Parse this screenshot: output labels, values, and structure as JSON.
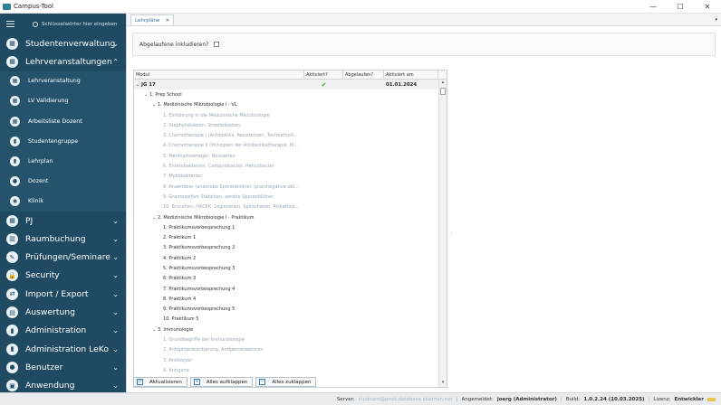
{
  "window": {
    "title": "Campus-Tool",
    "minimize": "—",
    "maximize": "☐",
    "close": "✕"
  },
  "sidebar": {
    "search_placeholder": "Schlüsselwörter hier eingeben",
    "items": [
      {
        "label": "Studentenverwaltung",
        "icon": "graduation-icon",
        "glyph": "▦",
        "chevron": "⌄"
      },
      {
        "label": "Lehrveranstaltungen",
        "icon": "graduation-icon",
        "glyph": "▦",
        "chevron": "⌃"
      },
      {
        "label": "PJ",
        "icon": "graduation-icon",
        "glyph": "▦",
        "chevron": "⌄"
      },
      {
        "label": "Raumbuchung",
        "icon": "building-icon",
        "glyph": "▥",
        "chevron": "⌄"
      },
      {
        "label": "Prüfungen/Seminare",
        "icon": "pen-icon",
        "glyph": "✎",
        "chevron": "⌄"
      },
      {
        "label": "Security",
        "icon": "lock-icon",
        "glyph": "🔒",
        "chevron": "⌄"
      },
      {
        "label": "Import / Export",
        "icon": "exchange-icon",
        "glyph": "⇄",
        "chevron": "⌄"
      },
      {
        "label": "Auswertung",
        "icon": "chart-icon",
        "glyph": "▤",
        "chevron": "⌄"
      },
      {
        "label": "Administration",
        "icon": "tool-icon",
        "glyph": "▮",
        "chevron": "⌄"
      },
      {
        "label": "Administration LeKo",
        "icon": "tool-icon",
        "glyph": "▮",
        "chevron": "⌄"
      },
      {
        "label": "Benutzer",
        "icon": "user-icon",
        "glyph": "●",
        "chevron": "⌄"
      },
      {
        "label": "Anwendung",
        "icon": "app-icon",
        "glyph": "▣",
        "chevron": "⌄"
      }
    ],
    "subitems": [
      {
        "label": "Lehrveranstaltung",
        "icon": "calendar-icon",
        "glyph": "▦"
      },
      {
        "label": "LV Validierung",
        "icon": "calendar-icon",
        "glyph": "▦"
      },
      {
        "label": "Arbeitsliste Dozent",
        "icon": "calendar-icon",
        "glyph": "▦"
      },
      {
        "label": "Studentengruppe",
        "icon": "tool-icon",
        "glyph": "▮"
      },
      {
        "label": "Lehrplan",
        "icon": "tool-icon",
        "glyph": "▮"
      },
      {
        "label": "Dozent",
        "icon": "user-icon",
        "glyph": "●"
      },
      {
        "label": "Klinik",
        "icon": "clinic-icon",
        "glyph": "◉"
      }
    ]
  },
  "tabs": {
    "active": "Lehrpläne",
    "close": "×",
    "menu": "▾"
  },
  "filter": {
    "label": "Abgelaufene inkludieren?"
  },
  "grid": {
    "columns": [
      "Modul",
      "Aktiviert?",
      "Abgelaufen?",
      "Aktiviert am"
    ],
    "root": {
      "label": "JG 17",
      "aktiviert": "✔",
      "aktiviert_am": "01.01.2024"
    },
    "rows": [
      {
        "text": "1. Prep School",
        "level": 1,
        "toggle": "⌄",
        "blur": false
      },
      {
        "text": "1. Medizinische Mikrobiologie I - VL",
        "level": 2,
        "toggle": "⌄",
        "blur": false
      },
      {
        "text": "1. Einführung in die Medizinische Mikrobiologie",
        "level": 3,
        "blur": true
      },
      {
        "text": "2. Staphylokokken, Streptokokken",
        "level": 3,
        "blur": true
      },
      {
        "text": "3. Chemotherapie I (Antibiotika, Resistenzen, Testmethod...",
        "level": 3,
        "blur": true
      },
      {
        "text": "4. Chemotherapie II (Prinzipien der Antibiotikatherapie, M...",
        "level": 3,
        "blur": true
      },
      {
        "text": "5. Meningitiserreger, Neisserien",
        "level": 3,
        "blur": true
      },
      {
        "text": "6. Enterobakterien, Campylobacter, Helicobacter",
        "level": 3,
        "blur": true
      },
      {
        "text": "7. Mykobakterien",
        "level": 3,
        "blur": true
      },
      {
        "text": "8. Anaerobier (anaerobe Sporenbildner, gramnegative obl...",
        "level": 3,
        "blur": true
      },
      {
        "text": "9. Grampositive Stäbchen, aerobe Sporenbildner",
        "level": 3,
        "blur": true
      },
      {
        "text": "10. Brucellen, HACEK, Legionellen, Spirochäten, Rickettsie...",
        "level": 3,
        "blur": true
      },
      {
        "text": "2. Medizinische Mikrobiologie I - Praktikum",
        "level": 2,
        "toggle": "⌄",
        "blur": false
      },
      {
        "text": "1. Praktikumsvorbesprechung 1",
        "level": 3,
        "blur": false
      },
      {
        "text": "2. Praktikum 1",
        "level": 3,
        "blur": false
      },
      {
        "text": "3. Praktikumsvorbesprechung 2",
        "level": 3,
        "blur": false
      },
      {
        "text": "4. Praktikum 2",
        "level": 3,
        "blur": false
      },
      {
        "text": "5. Praktikumsvorbesprechung 3",
        "level": 3,
        "blur": false
      },
      {
        "text": "6. Praktikum 3",
        "level": 3,
        "blur": false
      },
      {
        "text": "7. Praktikumsvorbesprechung 4",
        "level": 3,
        "blur": false
      },
      {
        "text": "8. Praktikum 4",
        "level": 3,
        "blur": false
      },
      {
        "text": "9. Praktikumsvorbesprechung 5",
        "level": 3,
        "blur": false
      },
      {
        "text": "10. Praktikum 5",
        "level": 3,
        "blur": false
      },
      {
        "text": "3. Immunologie",
        "level": 2,
        "toggle": "⌄",
        "blur": false
      },
      {
        "text": "1. Grundbegriffe der Immunbiologie",
        "level": 3,
        "blur": true
      },
      {
        "text": "2. Antigenpräsentierung, Antigenrezeptoren",
        "level": 3,
        "blur": true
      },
      {
        "text": "3. Antikörper",
        "level": 3,
        "blur": true
      },
      {
        "text": "4. Antigene",
        "level": 3,
        "blur": true
      }
    ]
  },
  "buttons": {
    "refresh": {
      "label": "Aktualisieren",
      "glyph": "⟳"
    },
    "expand": {
      "label": "Alles aufklappen",
      "glyph": "+"
    },
    "collapse": {
      "label": "Alles zuklappen",
      "glyph": "−"
    }
  },
  "status": {
    "server_label": "Server:",
    "server_value": "studcard@prod.database.stadmin.net",
    "user_label": "Angemeldet:",
    "user_value": "joerg (Administrator)",
    "build_label": "Build:",
    "build_value": "1.0.2.24 (10.03.2025)",
    "license_label": "Lizenz:",
    "license_value": "Entwickler"
  }
}
